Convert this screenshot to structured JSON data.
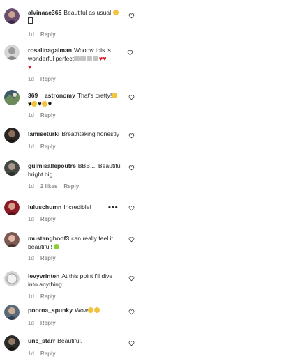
{
  "comments": [
    {
      "username": "alvinaac365",
      "text": "Beautiful as usual",
      "extra": "",
      "time": "1d",
      "likes": "",
      "reply_label": "Reply",
      "avatar_color": "#6b4e6f"
    },
    {
      "username": "rosalinagalman",
      "text": "Wooow this is wonderful perfect",
      "extra": "",
      "time": "1d",
      "likes": "",
      "reply_label": "Reply",
      "avatar_color": "#b8b8b8"
    },
    {
      "username": "369__astronomy",
      "text": "That's pretty!",
      "extra": "",
      "time": "1d",
      "likes": "",
      "reply_label": "Reply",
      "avatar_color": "#3c5a6a"
    },
    {
      "username": "lamiseturki",
      "text": "Breathtaking honestly",
      "extra": "",
      "time": "1d",
      "likes": "",
      "reply_label": "Reply",
      "avatar_color": "#2a2522"
    },
    {
      "username": "gulmisallepoutre",
      "text": "BBB.... Beautiful bright big..",
      "extra": "",
      "time": "1d",
      "likes": "2 likes",
      "reply_label": "Reply",
      "avatar_color": "#444a42"
    },
    {
      "username": "luluschumn",
      "text": "Incredible!",
      "extra": "",
      "time": "1d",
      "likes": "",
      "reply_label": "Reply",
      "avatar_color": "#8a1c2a"
    },
    {
      "username": "mustanghoof3",
      "text": "can really feel it beautiful!",
      "extra": "",
      "time": "1d",
      "likes": "",
      "reply_label": "Reply",
      "avatar_color": "#7a5a52"
    },
    {
      "username": "levyvrinten",
      "text": "At this point i'll dive into anything",
      "extra": "",
      "time": "1d",
      "likes": "",
      "reply_label": "Reply",
      "avatar_color": "#d3d3d3"
    },
    {
      "username": "poorna_spunky",
      "text": "Wow",
      "extra": "",
      "time": "1d",
      "likes": "",
      "reply_label": "Reply",
      "avatar_color": "#5a6a78"
    },
    {
      "username": "unc_starr",
      "text": "Beautiful.",
      "extra": "",
      "time": "1d",
      "likes": "",
      "reply_label": "Reply",
      "avatar_color": "#2b2a26"
    }
  ],
  "more_icon": "more-horizontal-icon",
  "like_icon": "heart-outline-icon"
}
